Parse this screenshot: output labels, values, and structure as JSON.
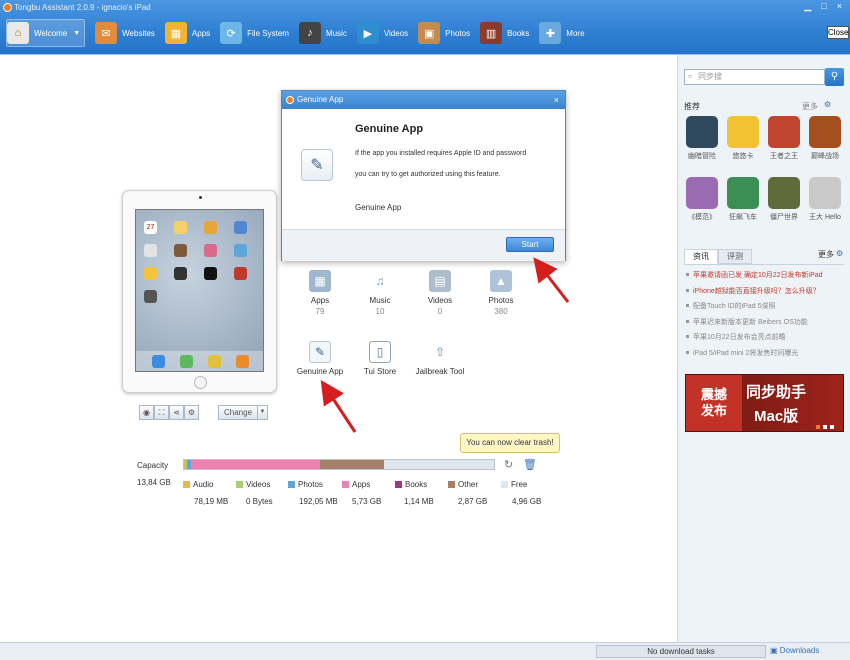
{
  "window": {
    "title": "Tongbu Assistant 2.0.9 - ignacio's iPad",
    "close_label": "Close",
    "min": "▁",
    "max": "□",
    "x": "×"
  },
  "nav": [
    {
      "label": "Welcome",
      "icon": "home-icon",
      "color": "#e9e9e9"
    },
    {
      "label": "Websites",
      "icon": "websites-icon",
      "color": "#e38b3b"
    },
    {
      "label": "Apps",
      "icon": "apps-icon",
      "color": "#f2b233"
    },
    {
      "label": "File System",
      "icon": "file-system-icon",
      "color": "#6cb6e8"
    },
    {
      "label": "Music",
      "icon": "music-icon",
      "color": "#444444"
    },
    {
      "label": "Videos",
      "icon": "videos-icon",
      "color": "#2d8fd0"
    },
    {
      "label": "Photos",
      "icon": "photos-icon",
      "color": "#c58a4d"
    },
    {
      "label": "Books",
      "icon": "books-icon",
      "color": "#8b3a2b"
    },
    {
      "label": "More",
      "icon": "more-icon",
      "color": "#6aa9de"
    }
  ],
  "dialog": {
    "header": "Genuine App",
    "title": "Genuine App",
    "line1": "If the app you installed requires Apple ID and password",
    "line2": "you can try to get authorized using this feature.",
    "name": "Genuine App",
    "start": "Start",
    "close": "×"
  },
  "ipad": {
    "change_label": "Change",
    "screen_date": "27"
  },
  "grid": [
    {
      "label": "Apps",
      "count": "79"
    },
    {
      "label": "Music",
      "count": "10"
    },
    {
      "label": "Videos",
      "count": "0"
    },
    {
      "label": "Photos",
      "count": "380"
    },
    {
      "label": "Genuine App",
      "count": ""
    },
    {
      "label": "Tui Store",
      "count": ""
    },
    {
      "label": "Jailbreak Tool",
      "count": ""
    }
  ],
  "capacity": {
    "label": "Capacity",
    "total": "13,84 GB",
    "tooltip": "You can now clear trash!",
    "segments": [
      {
        "name": "Audio",
        "value": "78,19 MB",
        "color": "#e5b84a",
        "fraction": 0.006
      },
      {
        "name": "Videos",
        "value": "0 Bytes",
        "color": "#a9cf72",
        "fraction": 0.004
      },
      {
        "name": "Photos",
        "value": "192,05 MB",
        "color": "#5fa4d8",
        "fraction": 0.014
      },
      {
        "name": "Apps",
        "value": "5,73 GB",
        "color": "#e884b0",
        "fraction": 0.414
      },
      {
        "name": "Books",
        "value": "1,14 MB",
        "color": "#9a3a84",
        "fraction": 0.001
      },
      {
        "name": "Other",
        "value": "2,87 GB",
        "color": "#a57f6a",
        "fraction": 0.207
      },
      {
        "name": "Free",
        "value": "4,96 GB",
        "color": "#dfe6ee",
        "fraction": 0.354
      }
    ]
  },
  "right": {
    "search_placeholder": "同步搜",
    "rec_title": "推荐",
    "more": "更多",
    "apps": [
      {
        "name": "幽暗冒险",
        "color": "#2f4a5e"
      },
      {
        "name": "悠悠卡",
        "color": "#f1c232"
      },
      {
        "name": "王者之王",
        "color": "#c0472d"
      },
      {
        "name": "巅峰战场",
        "color": "#a34f1e"
      },
      {
        "name": "《模范》",
        "color": "#9a6bb3"
      },
      {
        "name": "狂飙飞车",
        "color": "#3b8f55"
      },
      {
        "name": "僵尸世界",
        "color": "#5f6b3a"
      },
      {
        "name": "王大 Hello",
        "color": "#c9c9c9"
      }
    ],
    "tabs": [
      "资讯",
      "评测"
    ],
    "news_more": "更多",
    "news": [
      {
        "text": "苹果邀请函已发 确定10月22日发布新iPad",
        "color": "#c0392b"
      },
      {
        "text": "iPhone越狱能否直接升级吗？怎么升级？",
        "color": "#c0392b"
      },
      {
        "text": "配备Touch ID的iPad 5谍照",
        "color": "#888888"
      },
      {
        "text": "苹果迟来新版本更新 Beibers OS功能",
        "color": "#888888"
      },
      {
        "text": "苹果10月22日发布会亮点前瞻",
        "color": "#888888"
      },
      {
        "text": "iPad 5/iPad mini 2将发售时间曝光",
        "color": "#888888"
      }
    ],
    "banner": {
      "l1": "震撼",
      "l2": "发布",
      "r1": "同步助手",
      "r2": "Mac版"
    }
  },
  "status": {
    "no_download": "No download tasks",
    "downloads": "Downloads"
  }
}
